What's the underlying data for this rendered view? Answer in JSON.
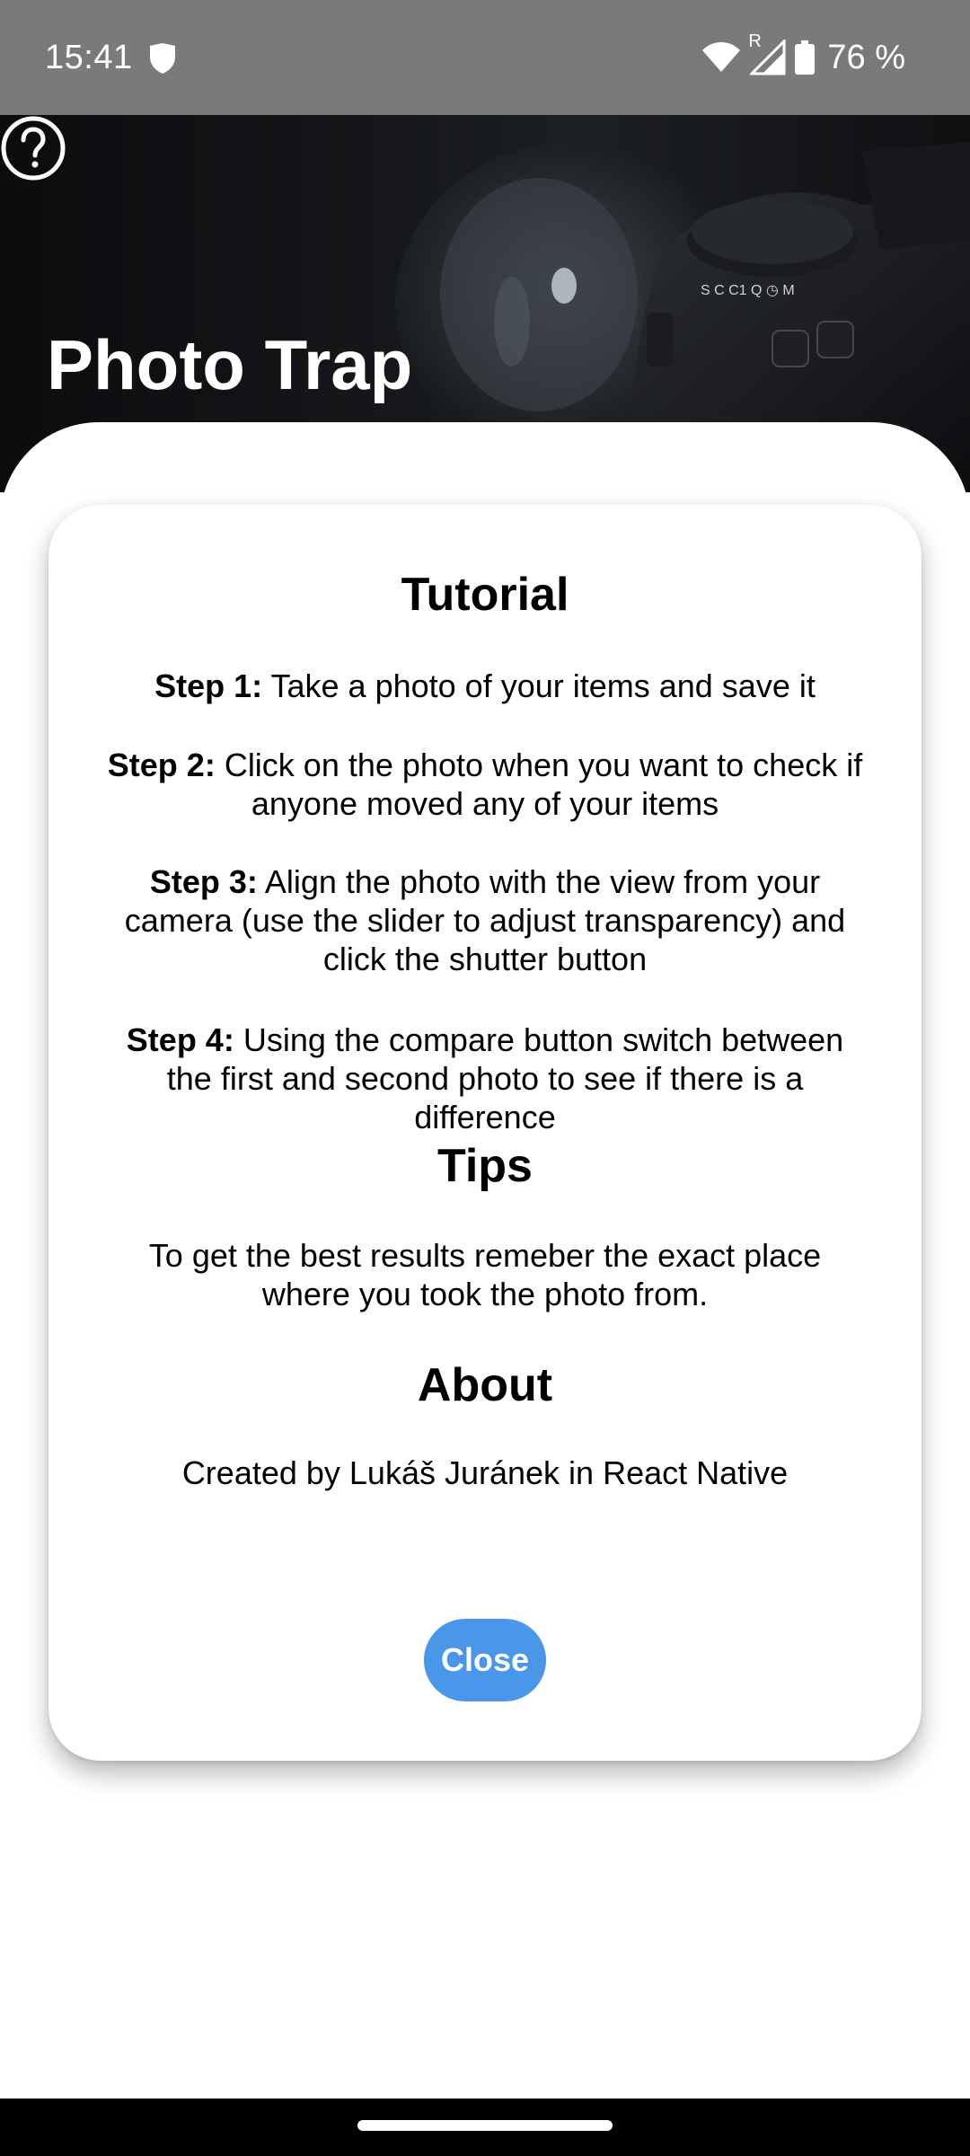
{
  "status_bar": {
    "time": "15:41",
    "battery": "76 %",
    "signal_roaming": "R",
    "icons": [
      "shield-icon",
      "wifi-icon",
      "signal-icon",
      "battery-icon"
    ]
  },
  "header": {
    "title": "Photo Trap",
    "help_icon": "question-circle-icon"
  },
  "modal": {
    "tutorial_heading": "Tutorial",
    "steps": [
      {
        "label": "Step 1:",
        "text": " Take a photo of your items and save it"
      },
      {
        "label": "Step 2:",
        "text": " Click on the photo when you want to check if anyone moved any of your items"
      },
      {
        "label": "Step 3:",
        "text": " Align the photo with the view from your camera (use the slider to adjust transparency) and click the shutter button"
      },
      {
        "label": "Step 4:",
        "text": " Using the compare button switch between the first and second photo to see if there is a difference"
      }
    ],
    "tips_heading": "Tips",
    "tips_text": "To get the best results remeber the exact place where you took the photo from.",
    "about_heading": "About",
    "about_text": "Created by Lukáš Juránek in React Native",
    "close_label": "Close"
  },
  "colors": {
    "status_bar": "#7a7a7a",
    "accent_button": "#4a96e8",
    "header_dark": "#111315"
  }
}
